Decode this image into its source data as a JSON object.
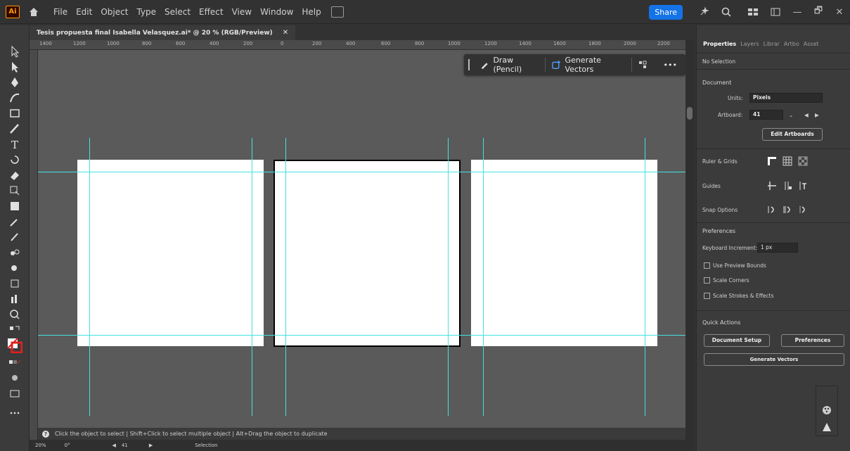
{
  "menubar": {
    "logo": "Ai",
    "items": [
      "File",
      "Edit",
      "Object",
      "Type",
      "Select",
      "Effect",
      "View",
      "Window",
      "Help"
    ],
    "share": "Share",
    "window_controls": [
      "—",
      "🗗",
      "✕"
    ]
  },
  "document": {
    "tab_title": "Tesis propuesta final Isabella Velasquez.ai* @ 20 % (RGB/Preview)",
    "close": "✕"
  },
  "ruler": {
    "labels": [
      "1400",
      "1200",
      "1000",
      "800",
      "600",
      "400",
      "200",
      "0",
      "200",
      "400",
      "600",
      "800",
      "1000",
      "1200",
      "1400",
      "1600",
      "1800",
      "2000",
      "2200"
    ]
  },
  "context_bar": {
    "draw": "Draw (Pencil)",
    "generate": "Generate Vectors",
    "more": "•••"
  },
  "status": {
    "message": "Click the object to select  |  Shift+Click to select multiple object  |  Alt+Drag the object to duplicate",
    "zoom": "20%",
    "rotation": "0°",
    "artboard": "41",
    "tool": "Selection"
  },
  "panel": {
    "tabs": [
      "Properties",
      "Layers",
      "Librar",
      "Artbo",
      "Asset"
    ],
    "no_selection": "No Selection",
    "document_title": "Document",
    "units_label": "Units:",
    "units_value": "Pixels",
    "artboard_label": "Artboard:",
    "artboard_value": "41",
    "edit_artboards": "Edit Artboards",
    "rulers_grids": "Ruler & Grids",
    "guides": "Guides",
    "snap_options": "Snap Options",
    "preferences_title": "Preferences",
    "keyboard_increment_label": "Keyboard Increment:",
    "keyboard_increment_value": "1 px",
    "use_preview_bounds": "Use Preview Bounds",
    "scale_corners": "Scale Corners",
    "scale_strokes": "Scale Strokes & Effects",
    "quick_actions": "Quick Actions",
    "document_setup": "Document Setup",
    "preferences_btn": "Preferences",
    "generate_vectors": "Generate Vectors"
  },
  "colors": {
    "guide": "#46e0e0",
    "accent": "#1473e6",
    "canvas": "#5a5a5a",
    "artboard": "#ffffff"
  }
}
